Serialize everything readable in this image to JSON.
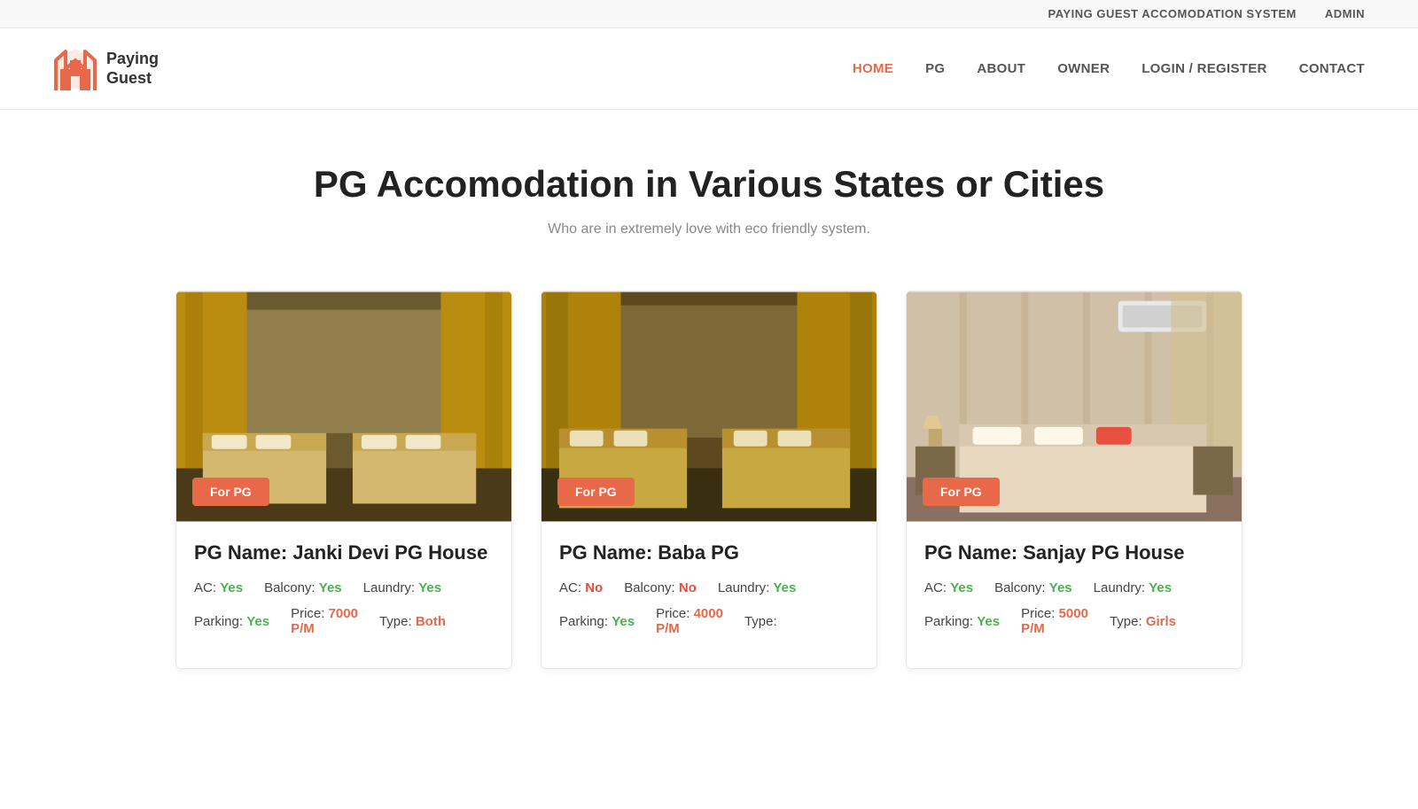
{
  "topbar": {
    "system_title": "PAYING GUEST ACCOMODATION SYSTEM",
    "admin_label": "ADMIN"
  },
  "header": {
    "logo_line1": "Paying",
    "logo_line2": "Guest",
    "nav": [
      {
        "label": "HOME",
        "active": true,
        "id": "home"
      },
      {
        "label": "PG",
        "active": false,
        "id": "pg"
      },
      {
        "label": "ABOUT",
        "active": false,
        "id": "about"
      },
      {
        "label": "OWNER",
        "active": false,
        "id": "owner"
      },
      {
        "label": "LOGIN / REGISTER",
        "active": false,
        "id": "login-register"
      },
      {
        "label": "CONTACT",
        "active": false,
        "id": "contact"
      }
    ]
  },
  "hero": {
    "title": "PG Accomodation in Various States or Cities",
    "subtitle": "Who are in extremely love with eco friendly system."
  },
  "cards": [
    {
      "id": "card1",
      "badge": "For PG",
      "name": "PG Name: Janki Devi PG House",
      "ac": "Yes",
      "ac_status": "yes",
      "balcony": "Yes",
      "balcony_status": "yes",
      "laundry": "Yes",
      "laundry_status": "yes",
      "parking": "Yes",
      "parking_status": "yes",
      "price": "7000",
      "price_unit": "P/M",
      "type": "Both",
      "type_status": "both",
      "room_style": "room1"
    },
    {
      "id": "card2",
      "badge": "For PG",
      "name": "PG Name: Baba PG",
      "ac": "No",
      "ac_status": "no",
      "balcony": "No",
      "balcony_status": "no",
      "laundry": "Yes",
      "laundry_status": "yes",
      "parking": "Yes",
      "parking_status": "yes",
      "price": "4000",
      "price_unit": "P/M",
      "type": "",
      "type_status": "none",
      "room_style": "room2"
    },
    {
      "id": "card3",
      "badge": "For PG",
      "name": "PG Name: Sanjay PG House",
      "ac": "Yes",
      "ac_status": "yes",
      "balcony": "Yes",
      "balcony_status": "yes",
      "laundry": "Yes",
      "laundry_status": "yes",
      "parking": "Yes",
      "parking_status": "yes",
      "price": "5000",
      "price_unit": "P/M",
      "type": "Girls",
      "type_status": "girls",
      "room_style": "room3"
    }
  ]
}
